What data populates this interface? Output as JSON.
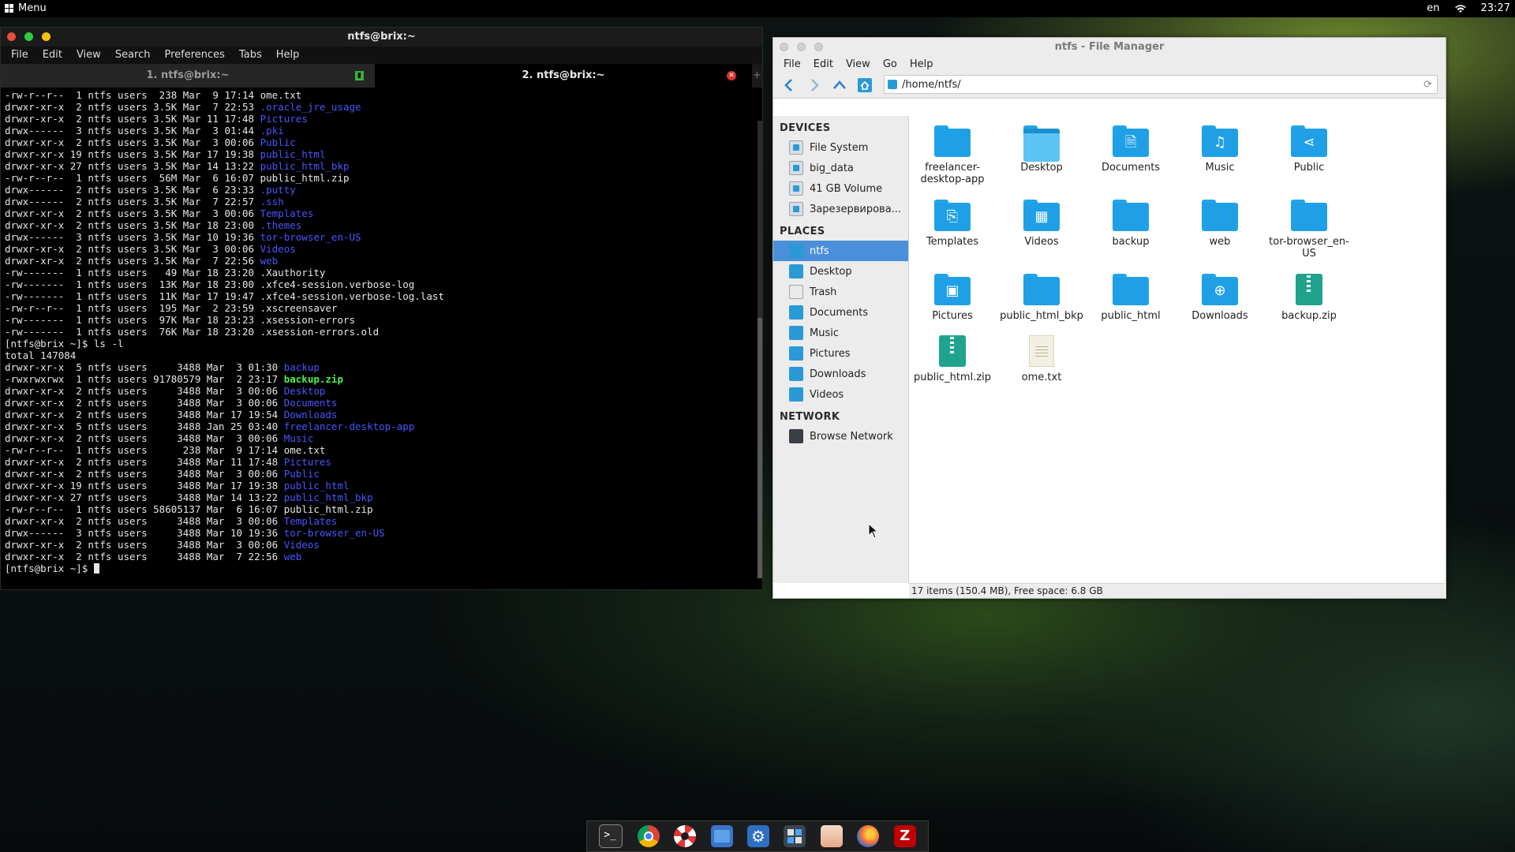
{
  "panel": {
    "menu_label": "Menu",
    "lang": "en",
    "clock": "23:27"
  },
  "terminal": {
    "title": "ntfs@brix:~",
    "menu": [
      "File",
      "Edit",
      "View",
      "Search",
      "Preferences",
      "Tabs",
      "Help"
    ],
    "tabs": [
      {
        "label": "1. ntfs@brix:~"
      },
      {
        "label": "2. ntfs@brix:~"
      }
    ],
    "lines": [
      {
        "prefix": "-rw-r--r--  1 ntfs users  238 Mar  9 17:14 ",
        "name": "ome.txt",
        "type": "file"
      },
      {
        "prefix": "drwxr-xr-x  2 ntfs users 3.5K Mar  7 22:53 ",
        "name": ".oracle_jre_usage",
        "type": "dir"
      },
      {
        "prefix": "drwxr-xr-x  2 ntfs users 3.5K Mar 11 17:48 ",
        "name": "Pictures",
        "type": "dir"
      },
      {
        "prefix": "drwx------  3 ntfs users 3.5K Mar  3 01:44 ",
        "name": ".pki",
        "type": "dir"
      },
      {
        "prefix": "drwxr-xr-x  2 ntfs users 3.5K Mar  3 00:06 ",
        "name": "Public",
        "type": "dir"
      },
      {
        "prefix": "drwxr-xr-x 19 ntfs users 3.5K Mar 17 19:38 ",
        "name": "public_html",
        "type": "dir"
      },
      {
        "prefix": "drwxr-xr-x 27 ntfs users 3.5K Mar 14 13:22 ",
        "name": "public_html_bkp",
        "type": "dir"
      },
      {
        "prefix": "-rw-r--r--  1 ntfs users  56M Mar  6 16:07 ",
        "name": "public_html.zip",
        "type": "file"
      },
      {
        "prefix": "drwx------  2 ntfs users 3.5K Mar  6 23:33 ",
        "name": ".putty",
        "type": "dir"
      },
      {
        "prefix": "drwx------  2 ntfs users 3.5K Mar  7 22:57 ",
        "name": ".ssh",
        "type": "dir"
      },
      {
        "prefix": "drwxr-xr-x  2 ntfs users 3.5K Mar  3 00:06 ",
        "name": "Templates",
        "type": "dir"
      },
      {
        "prefix": "drwxr-xr-x  2 ntfs users 3.5K Mar 18 23:00 ",
        "name": ".themes",
        "type": "dir"
      },
      {
        "prefix": "drwx------  3 ntfs users 3.5K Mar 10 19:36 ",
        "name": "tor-browser_en-US",
        "type": "dir"
      },
      {
        "prefix": "drwxr-xr-x  2 ntfs users 3.5K Mar  3 00:06 ",
        "name": "Videos",
        "type": "dir"
      },
      {
        "prefix": "drwxr-xr-x  2 ntfs users 3.5K Mar  7 22:56 ",
        "name": "web",
        "type": "dir"
      },
      {
        "prefix": "-rw-------  1 ntfs users   49 Mar 18 23:20 ",
        "name": ".Xauthority",
        "type": "file"
      },
      {
        "prefix": "-rw-------  1 ntfs users  13K Mar 18 23:00 ",
        "name": ".xfce4-session.verbose-log",
        "type": "file"
      },
      {
        "prefix": "-rw-------  1 ntfs users  11K Mar 17 19:47 ",
        "name": ".xfce4-session.verbose-log.last",
        "type": "file"
      },
      {
        "prefix": "-rw-r--r--  1 ntfs users  195 Mar  2 23:59 ",
        "name": ".xscreensaver",
        "type": "file"
      },
      {
        "prefix": "-rw-------  1 ntfs users  97K Mar 18 23:23 ",
        "name": ".xsession-errors",
        "type": "file"
      },
      {
        "prefix": "-rw-------  1 ntfs users  76K Mar 18 23:20 ",
        "name": ".xsession-errors.old",
        "type": "file"
      },
      {
        "prefix": "[ntfs@brix ~]$ ls -l",
        "name": "",
        "type": "file"
      },
      {
        "prefix": "total 147084",
        "name": "",
        "type": "file"
      },
      {
        "prefix": "drwxr-xr-x  5 ntfs users     3488 Mar  3 01:30 ",
        "name": "backup",
        "type": "dir"
      },
      {
        "prefix": "-rwxrwxrwx  1 ntfs users 91780579 Mar  2 23:17 ",
        "name": "backup.zip",
        "type": "exec"
      },
      {
        "prefix": "drwxr-xr-x  2 ntfs users     3488 Mar  3 00:06 ",
        "name": "Desktop",
        "type": "dir"
      },
      {
        "prefix": "drwxr-xr-x  2 ntfs users     3488 Mar  3 00:06 ",
        "name": "Documents",
        "type": "dir"
      },
      {
        "prefix": "drwxr-xr-x  2 ntfs users     3488 Mar 17 19:54 ",
        "name": "Downloads",
        "type": "dir"
      },
      {
        "prefix": "drwxr-xr-x  5 ntfs users     3488 Jan 25 03:40 ",
        "name": "freelancer-desktop-app",
        "type": "dir"
      },
      {
        "prefix": "drwxr-xr-x  2 ntfs users     3488 Mar  3 00:06 ",
        "name": "Music",
        "type": "dir"
      },
      {
        "prefix": "-rw-r--r--  1 ntfs users      238 Mar  9 17:14 ",
        "name": "ome.txt",
        "type": "file"
      },
      {
        "prefix": "drwxr-xr-x  2 ntfs users     3488 Mar 11 17:48 ",
        "name": "Pictures",
        "type": "dir"
      },
      {
        "prefix": "drwxr-xr-x  2 ntfs users     3488 Mar  3 00:06 ",
        "name": "Public",
        "type": "dir"
      },
      {
        "prefix": "drwxr-xr-x 19 ntfs users     3488 Mar 17 19:38 ",
        "name": "public_html",
        "type": "dir"
      },
      {
        "prefix": "drwxr-xr-x 27 ntfs users     3488 Mar 14 13:22 ",
        "name": "public_html_bkp",
        "type": "dir"
      },
      {
        "prefix": "-rw-r--r--  1 ntfs users 58605137 Mar  6 16:07 ",
        "name": "public_html.zip",
        "type": "file"
      },
      {
        "prefix": "drwxr-xr-x  2 ntfs users     3488 Mar  3 00:06 ",
        "name": "Templates",
        "type": "dir"
      },
      {
        "prefix": "drwx------  3 ntfs users     3488 Mar 10 19:36 ",
        "name": "tor-browser_en-US",
        "type": "dir"
      },
      {
        "prefix": "drwxr-xr-x  2 ntfs users     3488 Mar  3 00:06 ",
        "name": "Videos",
        "type": "dir"
      },
      {
        "prefix": "drwxr-xr-x  2 ntfs users     3488 Mar  7 22:56 ",
        "name": "web",
        "type": "dir"
      }
    ],
    "prompt": "[ntfs@brix ~]$ "
  },
  "filemanager": {
    "title": "ntfs - File Manager",
    "menu": [
      "File",
      "Edit",
      "View",
      "Go",
      "Help"
    ],
    "path": "/home/ntfs/",
    "sidebar": {
      "devices_heading": "DEVICES",
      "devices": [
        "File System",
        "big_data",
        "41 GB Volume",
        "Зарезервирова..."
      ],
      "places_heading": "PLACES",
      "places": [
        "ntfs",
        "Desktop",
        "Trash",
        "Documents",
        "Music",
        "Pictures",
        "Downloads",
        "Videos"
      ],
      "network_heading": "NETWORK",
      "network": [
        "Browse Network"
      ]
    },
    "items": [
      {
        "label": "freelancer-desktop-app",
        "kind": "folder",
        "icon": ""
      },
      {
        "label": "Desktop",
        "kind": "desktop",
        "icon": ""
      },
      {
        "label": "Documents",
        "kind": "folder",
        "icon": "document-icon"
      },
      {
        "label": "Music",
        "kind": "folder",
        "icon": "music-note-icon"
      },
      {
        "label": "Public",
        "kind": "folder",
        "icon": "share-icon"
      },
      {
        "label": "Templates",
        "kind": "folder",
        "icon": "template-icon"
      },
      {
        "label": "Videos",
        "kind": "folder",
        "icon": "film-icon"
      },
      {
        "label": "backup",
        "kind": "folder",
        "icon": ""
      },
      {
        "label": "web",
        "kind": "folder",
        "icon": ""
      },
      {
        "label": "tor-browser_en-US",
        "kind": "folder",
        "icon": ""
      },
      {
        "label": "Pictures",
        "kind": "folder",
        "icon": "image-icon"
      },
      {
        "label": "public_html_bkp",
        "kind": "folder",
        "icon": ""
      },
      {
        "label": "public_html",
        "kind": "folder",
        "icon": ""
      },
      {
        "label": "Downloads",
        "kind": "folder",
        "icon": "download-icon"
      },
      {
        "label": "backup.zip",
        "kind": "zip",
        "icon": ""
      },
      {
        "label": "public_html.zip",
        "kind": "zip",
        "icon": ""
      },
      {
        "label": "ome.txt",
        "kind": "txt",
        "icon": ""
      }
    ],
    "status": "17 items (150.4 MB), Free space: 6.8 GB"
  },
  "dock": {
    "apps": [
      "terminal-icon",
      "chrome-icon",
      "lifesaver-icon",
      "files-icon",
      "settings-gear-icon",
      "calculator-icon",
      "image-viewer-icon",
      "firefox-icon",
      "filezilla-icon"
    ]
  },
  "colors": {
    "accent": "#4a8fd9",
    "folder": "#1fa0e6",
    "dir_text": "#4b55ff",
    "exec_text": "#4cef4c"
  }
}
